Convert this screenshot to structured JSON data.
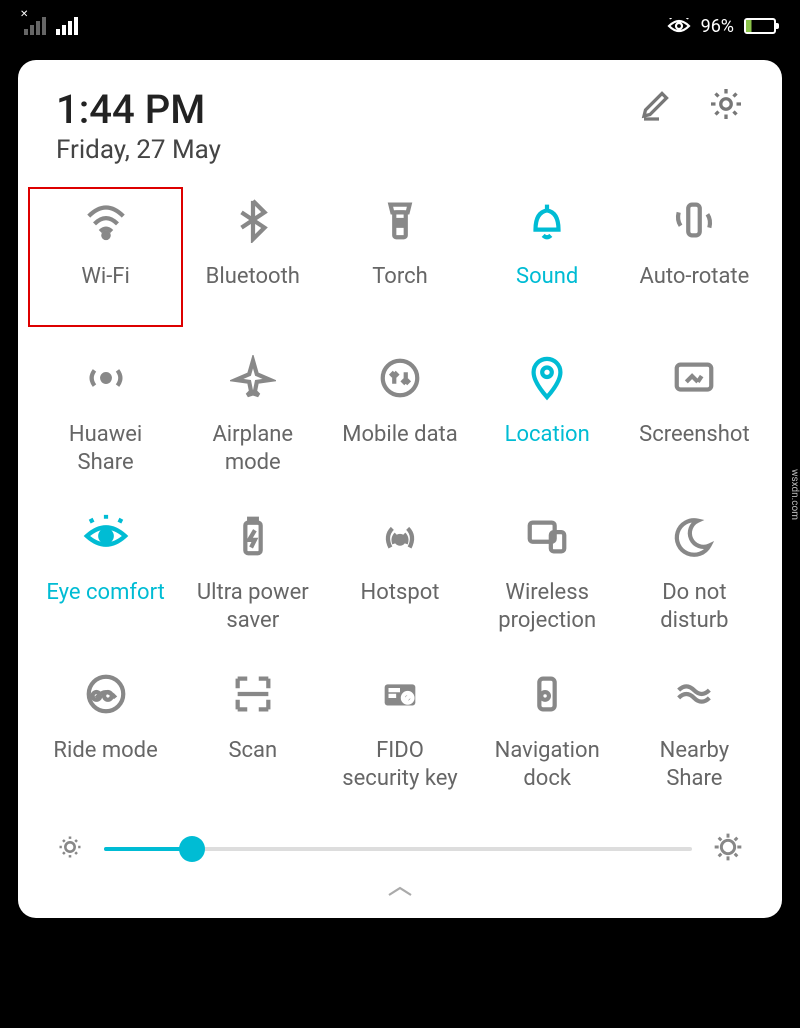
{
  "status": {
    "battery_percent": "96%"
  },
  "header": {
    "time": "1:44 PM",
    "date": "Friday, 27 May"
  },
  "tiles": [
    {
      "label": "Wi-Fi",
      "active": false,
      "highlighted": true,
      "icon": "wifi"
    },
    {
      "label": "Bluetooth",
      "active": false,
      "highlighted": false,
      "icon": "bluetooth"
    },
    {
      "label": "Torch",
      "active": false,
      "highlighted": false,
      "icon": "torch"
    },
    {
      "label": "Sound",
      "active": true,
      "highlighted": false,
      "icon": "bell"
    },
    {
      "label": "Auto-rotate",
      "active": false,
      "highlighted": false,
      "icon": "rotate"
    },
    {
      "label": "Huawei\nShare",
      "active": false,
      "highlighted": false,
      "icon": "share-radar"
    },
    {
      "label": "Airplane\nmode",
      "active": false,
      "highlighted": false,
      "icon": "airplane"
    },
    {
      "label": "Mobile data",
      "active": false,
      "highlighted": false,
      "icon": "mobile-data"
    },
    {
      "label": "Location",
      "active": true,
      "highlighted": false,
      "icon": "location"
    },
    {
      "label": "Screenshot",
      "active": false,
      "highlighted": false,
      "icon": "screenshot"
    },
    {
      "label": "Eye comfort",
      "active": true,
      "highlighted": false,
      "icon": "eye"
    },
    {
      "label": "Ultra power\nsaver",
      "active": false,
      "highlighted": false,
      "icon": "battery-saver"
    },
    {
      "label": "Hotspot",
      "active": false,
      "highlighted": false,
      "icon": "hotspot"
    },
    {
      "label": "Wireless\nprojection",
      "active": false,
      "highlighted": false,
      "icon": "projection"
    },
    {
      "label": "Do not\ndisturb",
      "active": false,
      "highlighted": false,
      "icon": "moon"
    },
    {
      "label": "Ride mode",
      "active": false,
      "highlighted": false,
      "icon": "ride"
    },
    {
      "label": "Scan",
      "active": false,
      "highlighted": false,
      "icon": "scan"
    },
    {
      "label": "FIDO\nsecurity key",
      "active": false,
      "highlighted": false,
      "icon": "fido"
    },
    {
      "label": "Navigation\ndock",
      "active": false,
      "highlighted": false,
      "icon": "navdock"
    },
    {
      "label": "Nearby\nShare",
      "active": false,
      "highlighted": false,
      "icon": "nearby"
    }
  ],
  "brightness": {
    "value_percent": 15
  },
  "colors": {
    "accent": "#00bcd4",
    "inactive": "#888888",
    "highlight_border": "#d00000"
  },
  "watermark": "wsxdn.com"
}
